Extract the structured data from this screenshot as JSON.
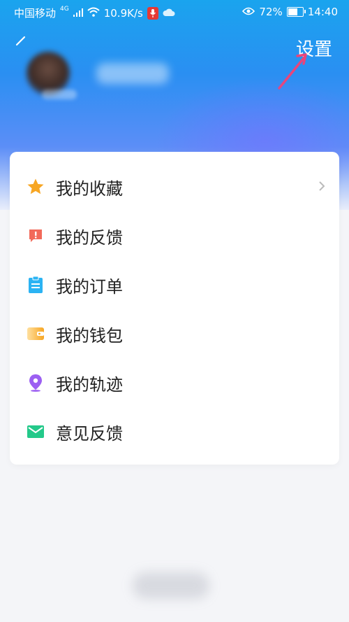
{
  "status_bar": {
    "carrier": "中国移动",
    "network_type": "4G",
    "speed": "10.9K/s",
    "battery": "72%",
    "battery_level": 0.72,
    "time": "14:40"
  },
  "header": {
    "settings_label": "设置"
  },
  "menu": {
    "items": [
      {
        "label": "我的收藏",
        "icon": "star-icon",
        "color": "#f7a623"
      },
      {
        "label": "我的反馈",
        "icon": "feedback-alert-icon",
        "color": "#f26a5a"
      },
      {
        "label": "我的订单",
        "icon": "clipboard-icon",
        "color": "#2bb3f3"
      },
      {
        "label": "我的钱包",
        "icon": "wallet-icon",
        "color": "#f7b733"
      },
      {
        "label": "我的轨迹",
        "icon": "location-pin-icon",
        "color": "#9c5ff2"
      },
      {
        "label": "意见反馈",
        "icon": "mail-icon",
        "color": "#24c98a"
      }
    ]
  }
}
